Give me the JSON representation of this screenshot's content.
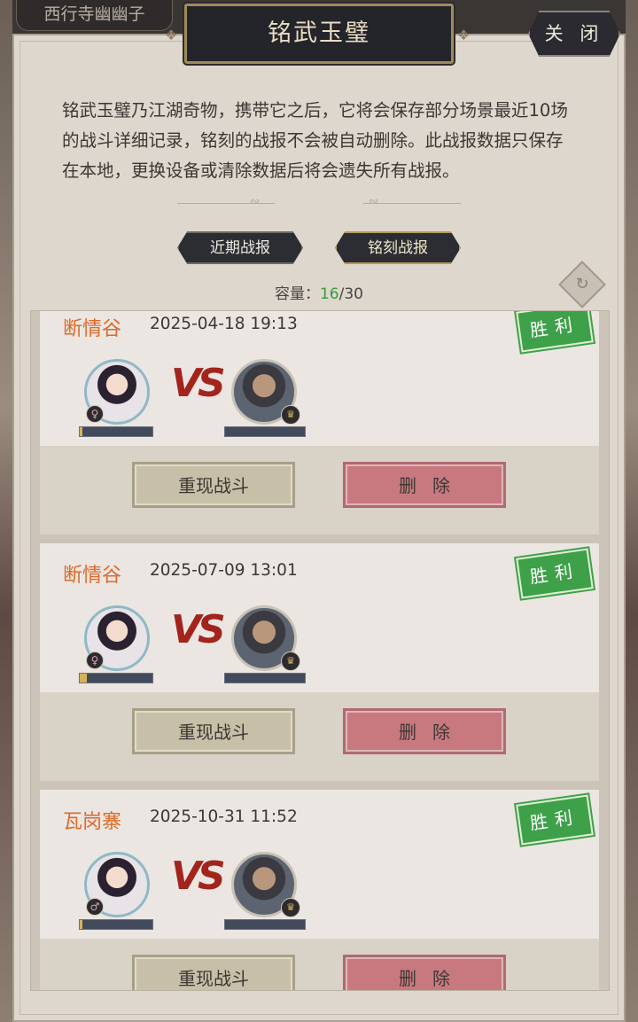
{
  "background_tab": "西行寺幽幽子",
  "dialog": {
    "title": "铭武玉璧",
    "close_label": "关 闭",
    "description": "铭武玉璧乃江湖奇物，携带它之后，它将会保存部分场景最近10场的战斗详细记录，铭刻的战报不会被自动删除。此战报数据只保存在本地，更换设备或清除数据后将会遗失所有战报。"
  },
  "tabs": {
    "recent": "近期战报",
    "engraved": "铭刻战报",
    "active": "engraved"
  },
  "capacity": {
    "label": "容量：",
    "used": "16",
    "separator": "/",
    "total": "30"
  },
  "records": [
    {
      "location": "断情谷",
      "time": "2025-04-18 19:13",
      "result": "胜利",
      "player_gender": "♀",
      "opponent_rank": "♛",
      "vs": "VS",
      "player_progress": 0.04,
      "replay_label": "重现战斗",
      "delete_label": "删除"
    },
    {
      "location": "断情谷",
      "time": "2025-07-09 13:01",
      "result": "胜利",
      "player_gender": "♀",
      "opponent_rank": "♛",
      "vs": "VS",
      "player_progress": 0.1,
      "replay_label": "重现战斗",
      "delete_label": "删除"
    },
    {
      "location": "瓦岗寨",
      "time": "2025-10-31 11:52",
      "result": "胜利",
      "player_gender": "♂",
      "opponent_rank": "♛",
      "vs": "VS",
      "player_progress": 0.04,
      "replay_label": "重现战斗",
      "delete_label": "删除"
    }
  ],
  "colors": {
    "location": "#dc6a2a",
    "capacity_used": "#3b9b3b",
    "victory_badge": "#3fa04a",
    "delete_button": "#c7797f",
    "replay_button": "#c7bfa7"
  }
}
